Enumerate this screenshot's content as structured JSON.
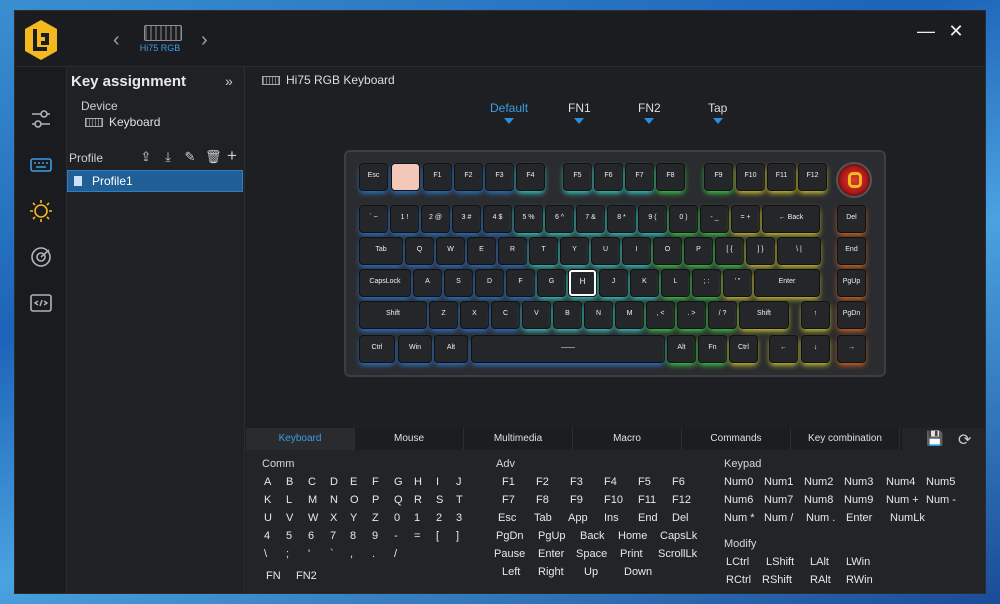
{
  "app": {
    "device_thumb_label": "Hi75 RGB"
  },
  "window": {
    "minimize": "—",
    "close": "✕"
  },
  "left_panel": {
    "title": "Key assignment",
    "collapse": "»",
    "device_label": "Device",
    "device_name": "Keyboard",
    "profile_label": "Profile",
    "profiles": [
      "Profile1"
    ]
  },
  "main": {
    "keyboard_title": "Hi75 RGB Keyboard",
    "layers": [
      "Default",
      "FN1",
      "FN2",
      "Tap"
    ]
  },
  "keyboard": {
    "row0": [
      "Esc",
      "",
      "F1",
      "F2",
      "F3",
      "F4",
      "F5",
      "F6",
      "F7",
      "F8",
      "F9",
      "F10",
      "F11",
      "F12"
    ],
    "row1": [
      "` ~",
      "1 !",
      "2 @",
      "3 #",
      "4 $",
      "5 %",
      "6 ^",
      "7 &",
      "8 *",
      "9 (",
      "0 )",
      "- _",
      "= +",
      "← Back",
      "Del"
    ],
    "row2": [
      "Tab",
      "Q",
      "W",
      "E",
      "R",
      "T",
      "Y",
      "U",
      "I",
      "O",
      "P",
      "[ {",
      "] }",
      "\\ |",
      "End"
    ],
    "row3": [
      "CapsLock",
      "A",
      "S",
      "D",
      "F",
      "G",
      "H",
      "J",
      "K",
      "L",
      "; :",
      "' \"",
      "Enter",
      "PgUp"
    ],
    "row4": [
      "Shift",
      "Z",
      "X",
      "C",
      "V",
      "B",
      "N",
      "M",
      ", <",
      ". >",
      "/ ?",
      "Shift",
      "↑",
      "PgDn"
    ],
    "row5": [
      "Ctrl",
      "Win",
      "Alt",
      "——",
      "Alt",
      "Fn",
      "Ctrl",
      "←",
      "↓",
      "→"
    ]
  },
  "tabs": [
    "Keyboard",
    "Mouse",
    "Multimedia",
    "Macro",
    "Commands",
    "Key combination"
  ],
  "comm": {
    "title": "Comm",
    "rows": [
      [
        "A",
        "B",
        "C",
        "D",
        "E",
        "F",
        "G",
        "H",
        "I",
        "J"
      ],
      [
        "K",
        "L",
        "M",
        "N",
        "O",
        "P",
        "Q",
        "R",
        "S",
        "T"
      ],
      [
        "U",
        "V",
        "W",
        "X",
        "Y",
        "Z",
        "0",
        "1",
        "2",
        "3"
      ],
      [
        "4",
        "5",
        "6",
        "7",
        "8",
        "9",
        "-",
        "=",
        "[",
        "]"
      ],
      [
        "\\",
        ";",
        "'",
        "`",
        ",",
        ".",
        "/"
      ],
      [
        "FN",
        "FN2"
      ]
    ]
  },
  "adv": {
    "title": "Adv",
    "rows": [
      [
        "F1",
        "F2",
        "F3",
        "F4",
        "F5",
        "F6"
      ],
      [
        "F7",
        "F8",
        "F9",
        "F10",
        "F11",
        "F12"
      ],
      [
        "Esc",
        "Tab",
        "App",
        "Ins",
        "End",
        "Del"
      ],
      [
        "PgDn",
        "PgUp",
        "Back",
        "Home",
        "CapsLk"
      ],
      [
        "Pause",
        "Enter",
        "Space",
        "Print",
        "ScrollLk"
      ],
      [
        "Left",
        "Right",
        "Up",
        "Down"
      ]
    ]
  },
  "keypad": {
    "title": "Keypad",
    "rows": [
      [
        "Num0",
        "Num1",
        "Num2",
        "Num3",
        "Num4",
        "Num5"
      ],
      [
        "Num6",
        "Num7",
        "Num8",
        "Num9",
        "Num +",
        "Num -"
      ],
      [
        "Num *",
        "Num /",
        "Num .",
        "Enter",
        "NumLk"
      ]
    ]
  },
  "modify": {
    "title": "Modify",
    "rows": [
      [
        "LCtrl",
        "LShift",
        "LAlt",
        "LWin"
      ],
      [
        "RCtrl",
        "RShift",
        "RAlt",
        "RWin"
      ]
    ]
  },
  "colors": {
    "accent": "#3d9ce6",
    "selected_profile": "#1f5f96"
  }
}
